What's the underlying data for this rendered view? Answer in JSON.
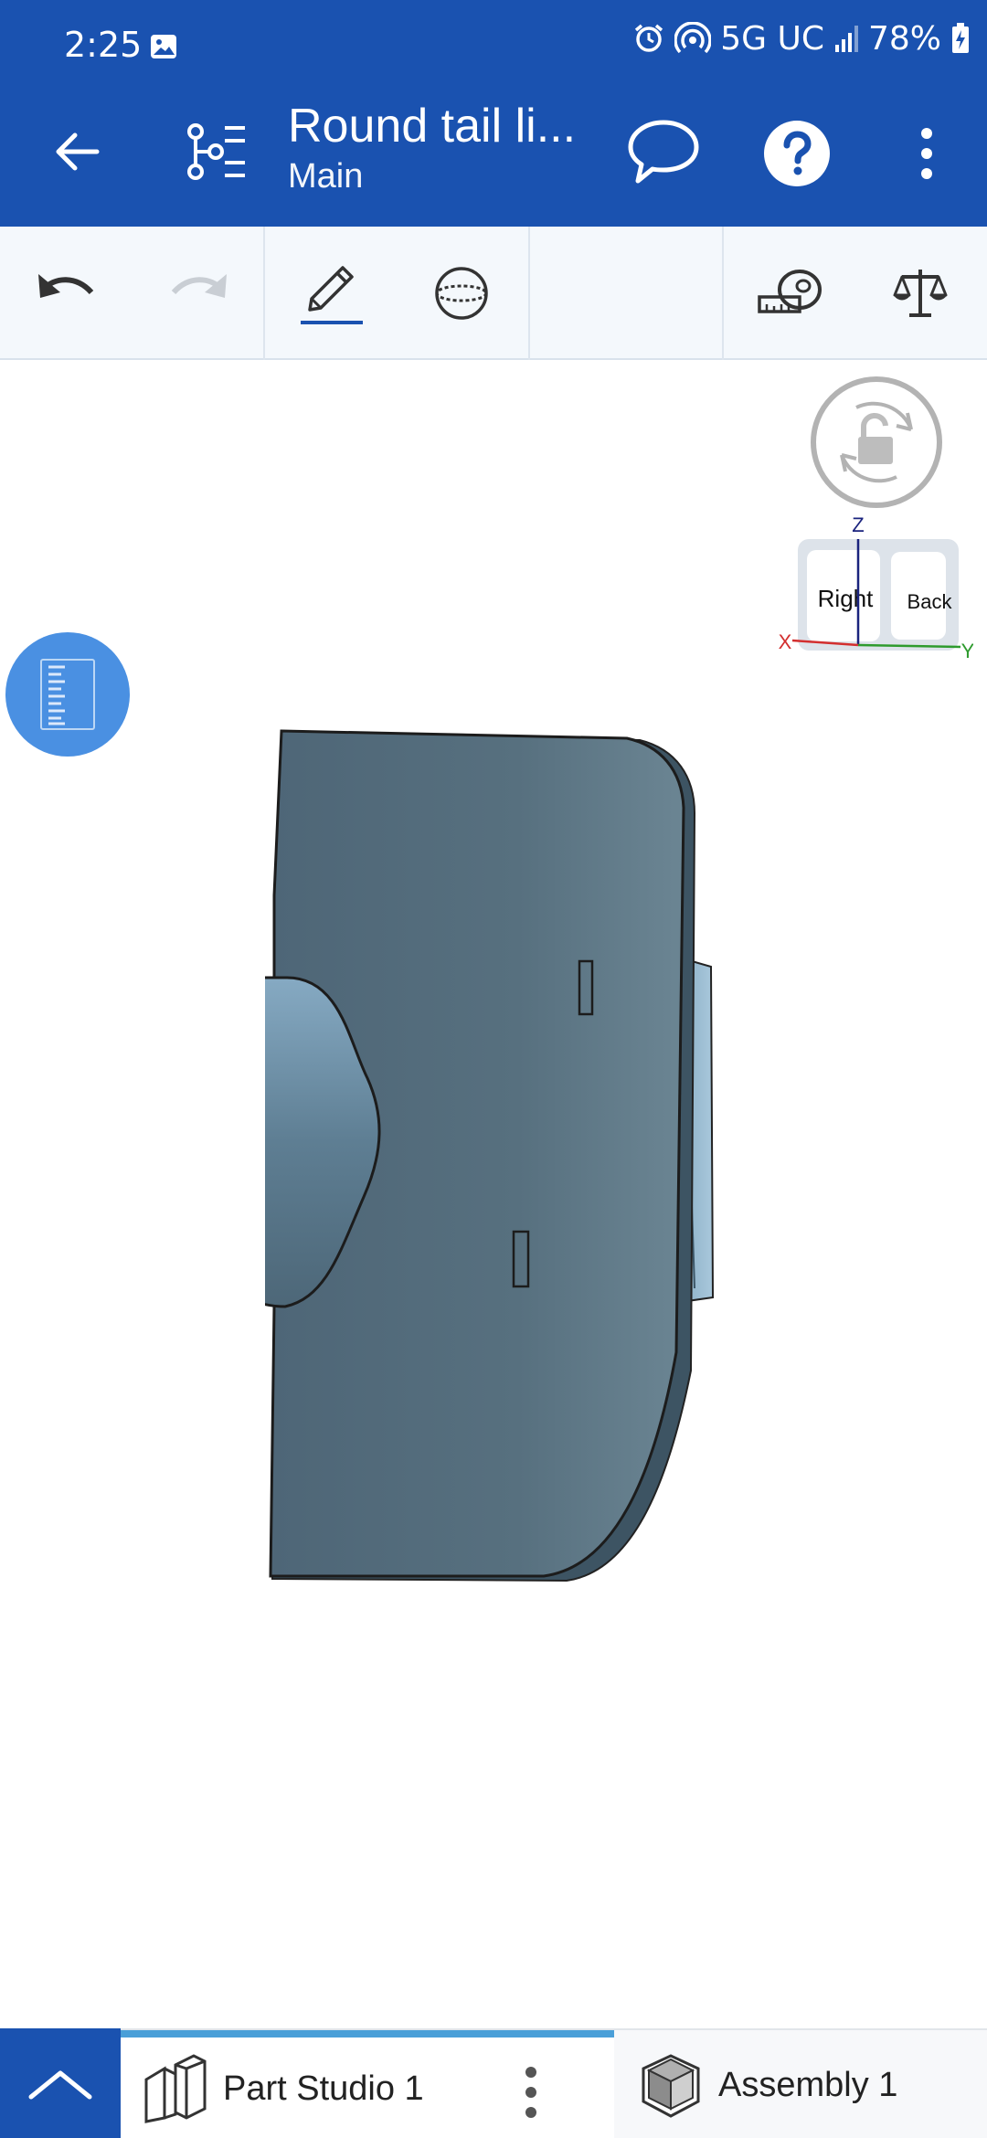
{
  "status": {
    "time": "2:25",
    "network": "5G UC",
    "battery": "78%",
    "icons": [
      "gallery-icon",
      "alarm-icon",
      "hotspot-icon",
      "signal-icon",
      "battery-icon"
    ]
  },
  "header": {
    "title": "Round tail li...",
    "subtitle": "Main",
    "icons": [
      "back-arrow-icon",
      "feature-tree-icon",
      "comment-icon",
      "help-icon",
      "more-vertical-icon"
    ]
  },
  "toolbar": {
    "items": [
      "undo-icon",
      "redo-icon",
      "sketch-pencil-icon",
      "plane-sphere-icon",
      "measure-tape-icon",
      "mass-properties-icon"
    ],
    "redo_enabled": false
  },
  "view_cube": {
    "axis_z": "Z",
    "axis_x": "X",
    "axis_y": "Y",
    "face_front": "Right",
    "face_side": "Back"
  },
  "colors": {
    "primary": "#1a52b0",
    "accent": "#4a90e2",
    "model": "#5a7585",
    "tab_active": "#4a9fd8"
  },
  "tabs": [
    {
      "label": "Part Studio 1",
      "icon": "part-studio-icon",
      "active": true
    },
    {
      "label": "Assembly 1",
      "icon": "assembly-icon",
      "active": false
    }
  ]
}
